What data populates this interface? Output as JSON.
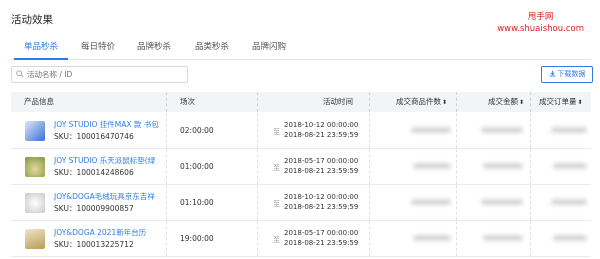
{
  "page": {
    "title": "活动效果"
  },
  "watermark": {
    "line1": "甩手网",
    "line2": "www.shuaishou.com"
  },
  "tabs": [
    {
      "label": "单品秒杀",
      "active": true
    },
    {
      "label": "每日特价",
      "active": false
    },
    {
      "label": "品牌秒杀",
      "active": false
    },
    {
      "label": "品类秒杀",
      "active": false
    },
    {
      "label": "品牌闪购",
      "active": false
    }
  ],
  "search": {
    "placeholder": "活动名称 / ID",
    "icon": "search-icon"
  },
  "download": {
    "label": "下载数据",
    "icon": "download-icon"
  },
  "table": {
    "headers": {
      "product": "产品信息",
      "session": "场次",
      "time": "活动时间",
      "items": "成交商品件数",
      "amount": "成交金额",
      "orders": "成交订单量"
    },
    "range_sep": "至",
    "rows": [
      {
        "name": "JOY STUDIO 挂件MAX 款 书包",
        "sku": "SKU：100016470746",
        "session": "02:00:00",
        "start": "2018-10-12 00:00:00",
        "end": "2018-08-21 23:59:59",
        "thumb_color": "#3a6fd8"
      },
      {
        "name": "JOY STUDIO 乐天派鼠标垫(绿",
        "sku": "SKU：100014248606",
        "session": "01:00:00",
        "start": "2018-05-17 00:00:00",
        "end": "2018-08-21 23:59:59",
        "thumb_color": "#7a9a3a"
      },
      {
        "name": "JOY&DOGA毛绒玩具京东吉祥",
        "sku": "SKU：100009900857",
        "session": "01:10:00",
        "start": "2018-10-12 00:00:00",
        "end": "2018-08-21 23:59:59",
        "thumb_color": "#c9c9c9"
      },
      {
        "name": "JOY&DOGA 2021新年台历",
        "sku": "SKU：100013225712",
        "session": "19:00:00",
        "start": "2018-05-17 00:00:00",
        "end": "2018-08-21 23:59:59",
        "thumb_color": "#b89a55"
      }
    ]
  }
}
